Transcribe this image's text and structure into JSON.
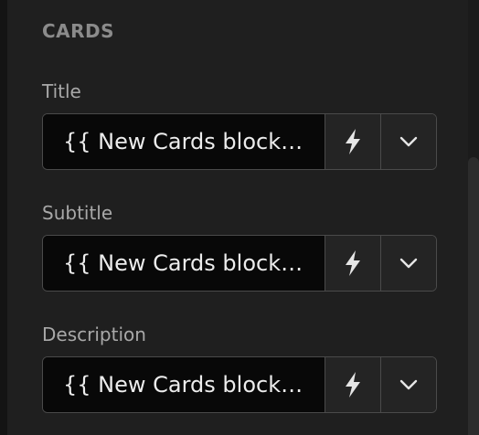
{
  "section": {
    "title": "CARDS"
  },
  "fields": [
    {
      "label": "Title",
      "value": "{{ New Cards block.…",
      "dynamic_icon": "lightning-bolt-icon",
      "dropdown_icon": "chevron-down-icon"
    },
    {
      "label": "Subtitle",
      "value": "{{ New Cards block.…",
      "dynamic_icon": "lightning-bolt-icon",
      "dropdown_icon": "chevron-down-icon"
    },
    {
      "label": "Description",
      "value": "{{ New Cards block.…",
      "dynamic_icon": "lightning-bolt-icon",
      "dropdown_icon": "chevron-down-icon"
    }
  ],
  "colors": {
    "panel_bg": "#1f1f1f",
    "input_bg": "#080808",
    "button_bg": "#242424",
    "border": "#4a4a4a",
    "label_text": "#a8a8a8",
    "section_text": "#8b8b8b",
    "value_text": "#ececec"
  }
}
